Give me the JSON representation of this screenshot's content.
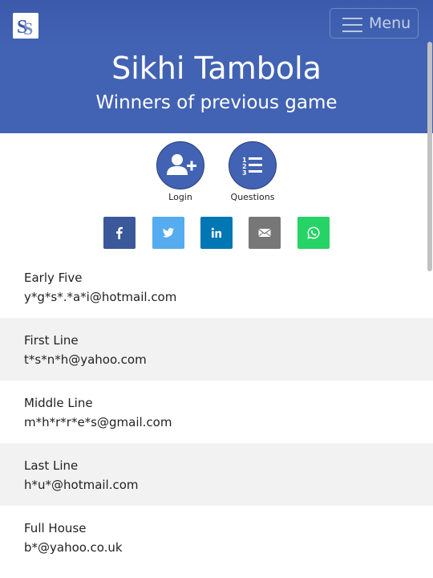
{
  "header": {
    "logo_text": "SS",
    "menu_label": "Menu",
    "title": "Sikhi Tambola",
    "subtitle": "Winners of previous game"
  },
  "actions": [
    {
      "label": "Login",
      "icon": "user-plus-icon"
    },
    {
      "label": "Questions",
      "icon": "numbered-list-icon"
    }
  ],
  "social": [
    {
      "icon": "facebook-icon",
      "color": "#3b5998"
    },
    {
      "icon": "twitter-icon",
      "color": "#55acee"
    },
    {
      "icon": "linkedin-icon",
      "color": "#0077b5"
    },
    {
      "icon": "email-icon",
      "color": "#777777"
    },
    {
      "icon": "whatsapp-icon",
      "color": "#25d366"
    }
  ],
  "colors": {
    "brand": "#4263b3",
    "row_alt": "#f2f2f2"
  },
  "winners": [
    {
      "title": "Early Five",
      "email": "y*g*s*.*a*i@hotmail.com"
    },
    {
      "title": "First Line",
      "email": "t*s*n*h@yahoo.com"
    },
    {
      "title": "Middle Line",
      "email": "m*h*r*r*e*s@gmail.com"
    },
    {
      "title": "Last Line",
      "email": "h*u*@hotmail.com"
    },
    {
      "title": "Full House",
      "email": "b*@yahoo.co.uk"
    }
  ]
}
